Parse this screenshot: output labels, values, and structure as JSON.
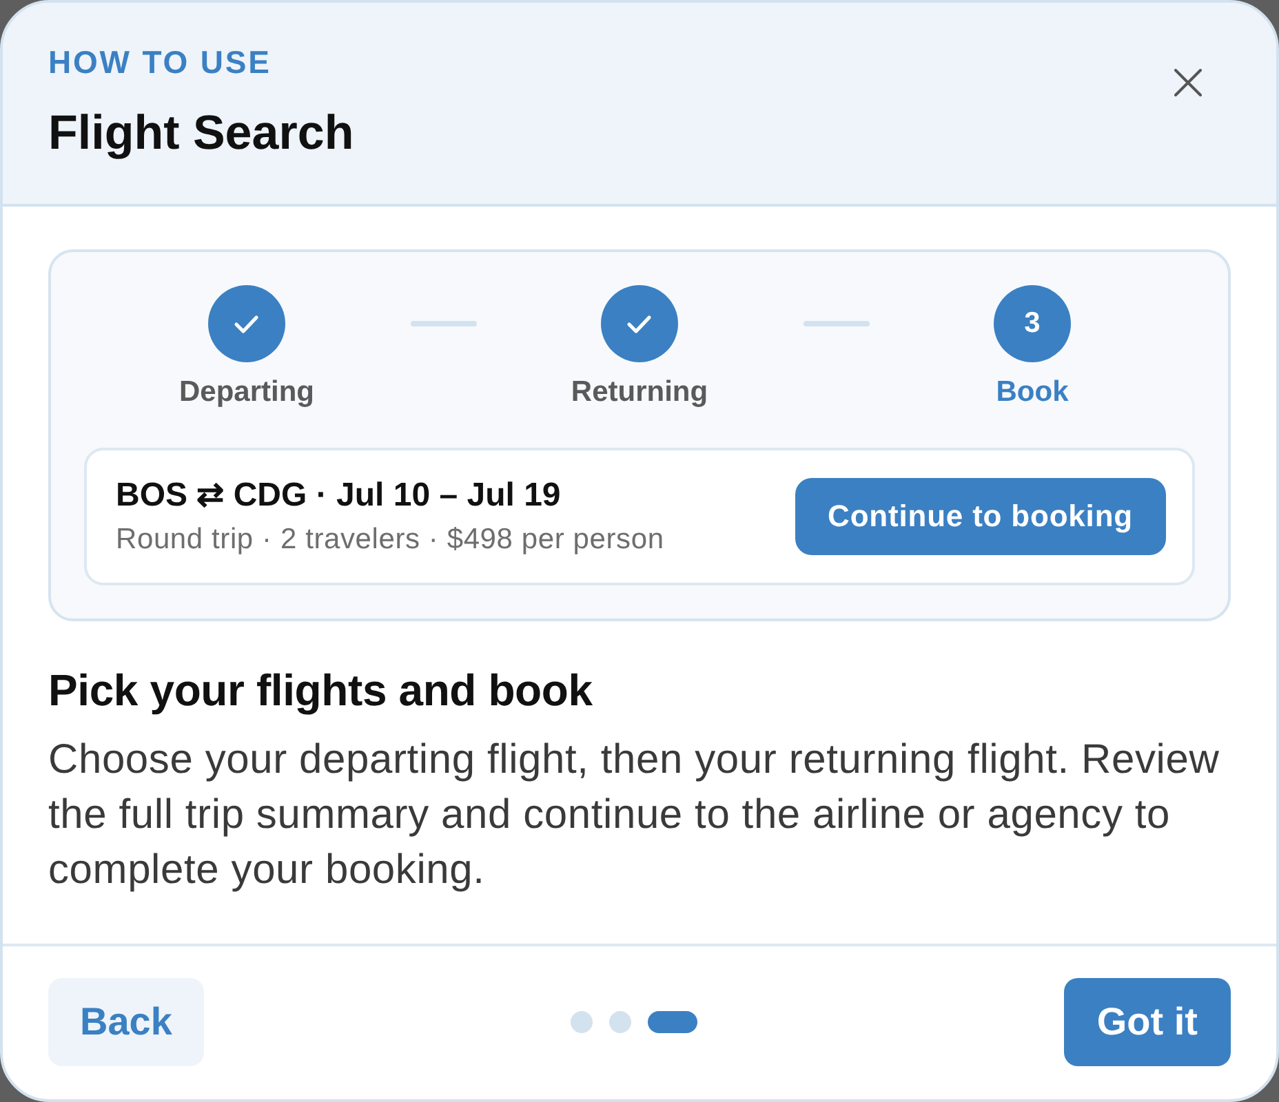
{
  "header": {
    "eyebrow": "HOW TO USE",
    "title": "Flight Search"
  },
  "steps": [
    {
      "label": "Departing",
      "completed": true,
      "selected": false
    },
    {
      "label": "Returning",
      "completed": true,
      "selected": false
    },
    {
      "label": "Book",
      "completed": false,
      "selected": true,
      "number": "3"
    }
  ],
  "trip": {
    "title": "BOS ⇄ CDG · Jul 10 – Jul 19",
    "details": "Round trip · 2 travelers · $498 per person",
    "button": "Continue to booking"
  },
  "heading": "Pick your flights and book",
  "body": "Choose your departing flight, then your returning flight. Review the full trip summary and continue to the airline or agency to complete your booking.",
  "footer": {
    "back": "Back",
    "pages": [
      {
        "selected": false
      },
      {
        "selected": false
      },
      {
        "selected": true
      }
    ],
    "done": "Got it"
  }
}
